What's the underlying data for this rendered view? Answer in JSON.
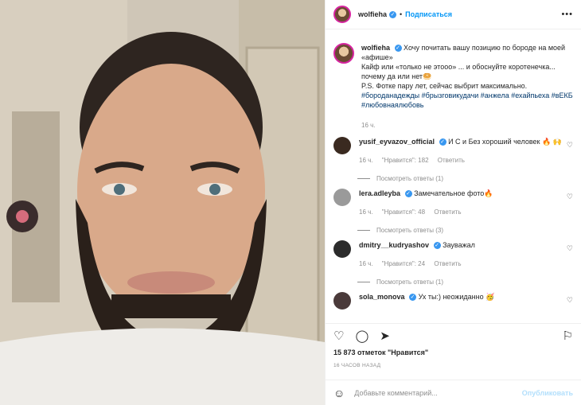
{
  "post": {
    "username": "wolfieha",
    "follow_label": "Подписаться",
    "caption_lines": [
      "Хочу почитать вашу позицию по бороде на моей «афише»",
      "Кайф или «только не этооо» ... и обоснуйте коротенечка... почему да или нет🥯",
      "P.S. Фотке пару лет, сейчас выбрит максимально."
    ],
    "hashtags": "#бороданадежды #брызговикудачи #анжела #ехайпьеха #вЕКБ #любовнаялюбовь",
    "caption_time": "16 ч."
  },
  "comments": [
    {
      "user": "yusif_eyvazov_official",
      "text": "И С и Без хороший человек 🔥 🙌",
      "time": "16 ч.",
      "likes": "\"Нравится\": 182",
      "reply": "Ответить",
      "answers": "Посмотреть ответы (1)"
    },
    {
      "user": "lera.adleyba",
      "text": "Замечательное фото🔥",
      "time": "16 ч.",
      "likes": "\"Нравится\": 48",
      "reply": "Ответить",
      "answers": "Посмотреть ответы (3)"
    },
    {
      "user": "dmitry__kudryashov",
      "text": "Зауважал",
      "time": "16 ч.",
      "likes": "\"Нравится\": 24",
      "reply": "Ответить",
      "answers": "Посмотреть ответы (1)"
    },
    {
      "user": "sola_monova",
      "text": "Ух ты:) неожиданно 🥳",
      "time": "",
      "likes": "",
      "reply": "",
      "answers": ""
    }
  ],
  "footer": {
    "likes": "15 873 отметок \"Нравится\"",
    "time": "16 ЧАСОВ НАЗАД",
    "placeholder": "Добавьте комментарий...",
    "publish": "Опубликовать"
  },
  "icons": {
    "like": "heart-icon",
    "comment": "comment-icon",
    "share": "paper-plane-icon",
    "save": "bookmark-icon",
    "emoji": "smile-icon"
  }
}
